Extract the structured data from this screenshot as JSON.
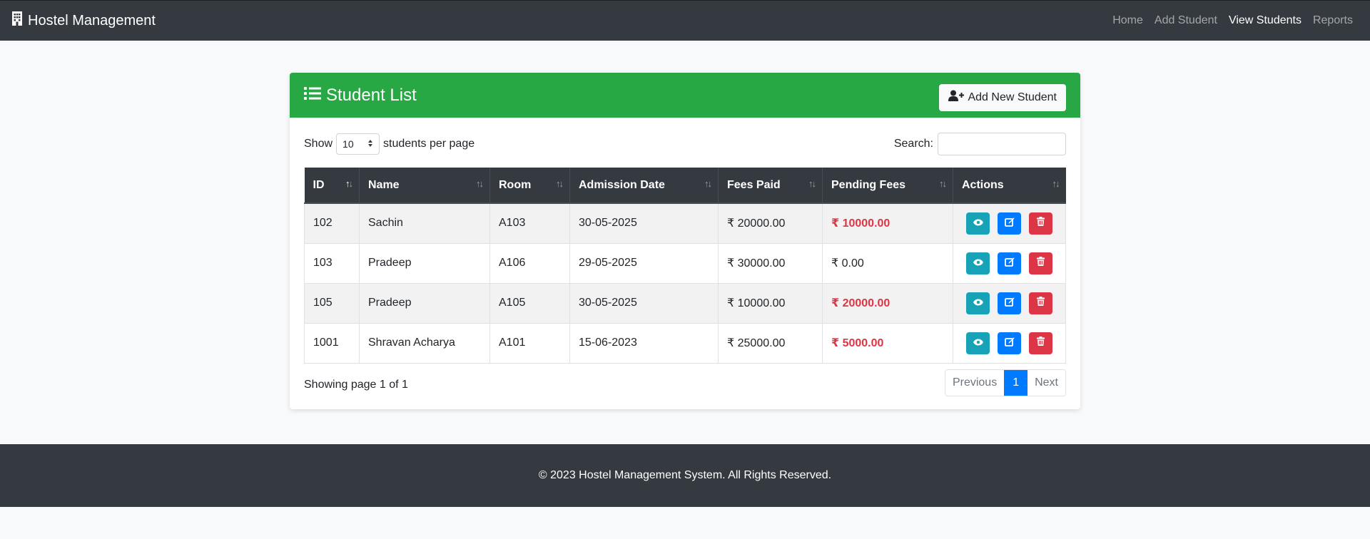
{
  "navbar": {
    "brand": "Hostel Management",
    "links": [
      {
        "label": "Home",
        "active": false
      },
      {
        "label": "Add Student",
        "active": false
      },
      {
        "label": "View Students",
        "active": true
      },
      {
        "label": "Reports",
        "active": false
      }
    ]
  },
  "card": {
    "title": "Student List",
    "add_button": "Add New Student",
    "show_label": "Show",
    "per_page_value": "10",
    "per_page_suffix": "students per page",
    "search_label": "Search:",
    "search_value": ""
  },
  "table": {
    "columns": [
      "ID",
      "Name",
      "Room",
      "Admission Date",
      "Fees Paid",
      "Pending Fees",
      "Actions"
    ],
    "rows": [
      {
        "id": "102",
        "name": "Sachin",
        "room": "A103",
        "date": "30-05-2025",
        "paid": "₹ 20000.00",
        "pending": "₹ 10000.00"
      },
      {
        "id": "103",
        "name": "Pradeep",
        "room": "A106",
        "date": "29-05-2025",
        "paid": "₹ 30000.00",
        "pending": "₹ 0.00"
      },
      {
        "id": "105",
        "name": "Pradeep",
        "room": "A105",
        "date": "30-05-2025",
        "paid": "₹ 10000.00",
        "pending": "₹ 20000.00"
      },
      {
        "id": "1001",
        "name": "Shravan Acharya",
        "room": "A101",
        "date": "15-06-2023",
        "paid": "₹ 25000.00",
        "pending": "₹ 5000.00"
      }
    ]
  },
  "pagination": {
    "info": "Showing page 1 of 1",
    "previous": "Previous",
    "current": "1",
    "next": "Next"
  },
  "footer": {
    "text": "© 2023 Hostel Management System. All Rights Reserved."
  },
  "colors": {
    "navbar": "#343a40",
    "header": "#28a745",
    "danger": "#dc3545",
    "info": "#17a2b8",
    "primary": "#007bff"
  }
}
